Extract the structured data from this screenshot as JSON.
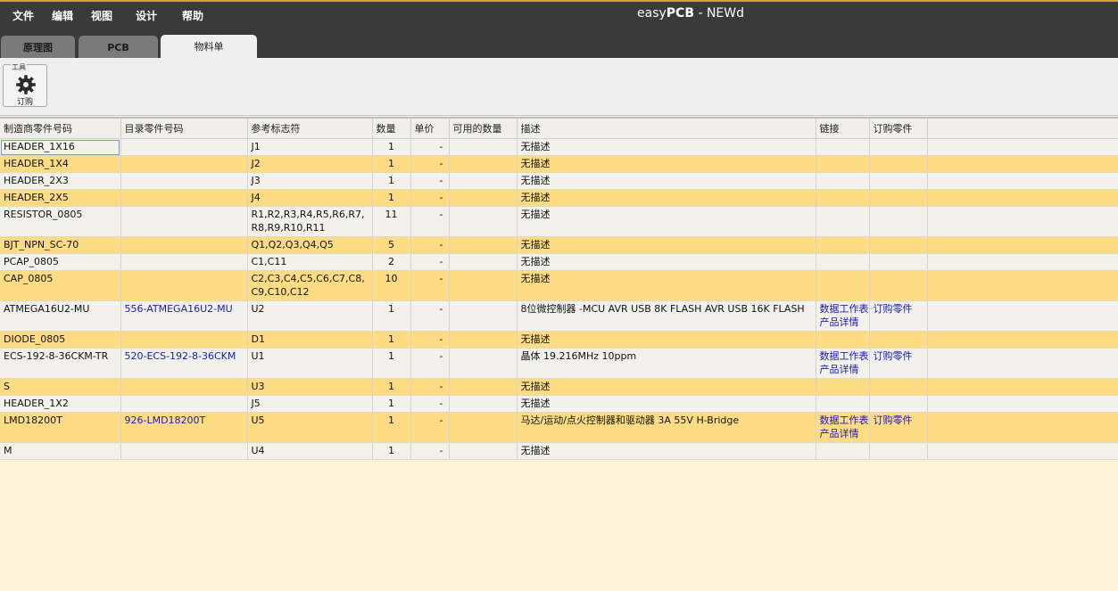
{
  "menu": [
    "文件",
    "编辑",
    "视图",
    "设计",
    "帮助"
  ],
  "title": {
    "prefix": "easy",
    "bold": "PCB",
    "suffix": " - NEWd"
  },
  "tabs": [
    {
      "label": "原理图",
      "active": false
    },
    {
      "label": "PCB",
      "active": false
    },
    {
      "label": "物料单",
      "active": true
    }
  ],
  "toolbar": {
    "group_label": "工具",
    "order_label": "订购",
    "icon": "gear-icon"
  },
  "columns": [
    "制造商零件号码",
    "目录零件号码",
    "参考标志符",
    "数量",
    "单价",
    "可用的数量",
    "描述",
    "链接",
    "订购零件",
    ""
  ],
  "rows": [
    {
      "mfr": "HEADER_1X16",
      "cat": "",
      "ref": "J1",
      "qty": "1",
      "price": "-",
      "avail": "",
      "desc": "无描述",
      "links": [],
      "order": ""
    },
    {
      "mfr": "HEADER_1X4",
      "cat": "",
      "ref": "J2",
      "qty": "1",
      "price": "-",
      "avail": "",
      "desc": "无描述",
      "links": [],
      "order": ""
    },
    {
      "mfr": "HEADER_2X3",
      "cat": "",
      "ref": "J3",
      "qty": "1",
      "price": "-",
      "avail": "",
      "desc": "无描述",
      "links": [],
      "order": ""
    },
    {
      "mfr": "HEADER_2X5",
      "cat": "",
      "ref": "J4",
      "qty": "1",
      "price": "-",
      "avail": "",
      "desc": "无描述",
      "links": [],
      "order": ""
    },
    {
      "mfr": "RESISTOR_0805",
      "cat": "",
      "ref": "R1,R2,R3,R4,R5,R6,R7,R8,R9,R10,R11",
      "qty": "11",
      "price": "-",
      "avail": "",
      "desc": "无描述",
      "links": [],
      "order": ""
    },
    {
      "mfr": "BJT_NPN_SC-70",
      "cat": "",
      "ref": "Q1,Q2,Q3,Q4,Q5",
      "qty": "5",
      "price": "-",
      "avail": "",
      "desc": "无描述",
      "links": [],
      "order": ""
    },
    {
      "mfr": "PCAP_0805",
      "cat": "",
      "ref": "C1,C11",
      "qty": "2",
      "price": "-",
      "avail": "",
      "desc": "无描述",
      "links": [],
      "order": ""
    },
    {
      "mfr": "CAP_0805",
      "cat": "",
      "ref": "C2,C3,C4,C5,C6,C7,C8,C9,C10,C12",
      "qty": "10",
      "price": "-",
      "avail": "",
      "desc": "无描述",
      "links": [],
      "order": ""
    },
    {
      "mfr": "ATMEGA16U2-MU",
      "cat": "556-ATMEGA16U2-MU",
      "ref": "U2",
      "qty": "1",
      "price": "-",
      "avail": "",
      "desc": "8位微控制器 -MCU AVR USB 8K FLASH AVR USB 16K FLASH",
      "links": [
        "数据工作表",
        "产品详情"
      ],
      "order": "订购零件"
    },
    {
      "mfr": "DIODE_0805",
      "cat": "",
      "ref": "D1",
      "qty": "1",
      "price": "-",
      "avail": "",
      "desc": "无描述",
      "links": [],
      "order": ""
    },
    {
      "mfr": "ECS-192-8-36CKM-TR",
      "cat": "520-ECS-192-8-36CKM",
      "ref": "U1",
      "qty": "1",
      "price": "-",
      "avail": "",
      "desc": "晶体 19.216MHz 10ppm",
      "links": [
        "数据工作表",
        "产品详情"
      ],
      "order": "订购零件"
    },
    {
      "mfr": "S",
      "cat": "",
      "ref": "U3",
      "qty": "1",
      "price": "-",
      "avail": "",
      "desc": "无描述",
      "links": [],
      "order": ""
    },
    {
      "mfr": "HEADER_1X2",
      "cat": "",
      "ref": "J5",
      "qty": "1",
      "price": "-",
      "avail": "",
      "desc": "无描述",
      "links": [],
      "order": ""
    },
    {
      "mfr": "LMD18200T",
      "cat": "926-LMD18200T",
      "ref": "U5",
      "qty": "1",
      "price": "-",
      "avail": "",
      "desc": "马达/运动/点火控制器和驱动器 3A 55V H-Bridge",
      "links": [
        "数据工作表",
        "产品详情"
      ],
      "order": "订购零件"
    },
    {
      "mfr": "M",
      "cat": "",
      "ref": "U4",
      "qty": "1",
      "price": "-",
      "avail": "",
      "desc": "无描述",
      "links": [],
      "order": ""
    }
  ]
}
